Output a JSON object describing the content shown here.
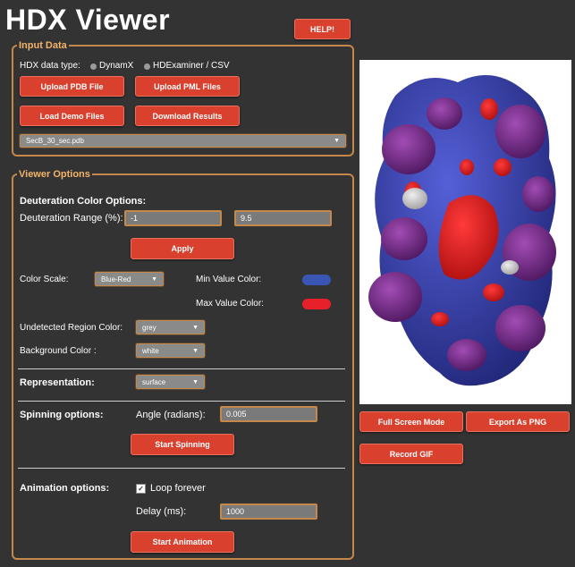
{
  "app": {
    "title": "HDX Viewer",
    "help_label": "HELP!"
  },
  "input_data": {
    "legend": "Input Data",
    "data_type_label": "HDX data type:",
    "options": [
      "DynamX",
      "HDExaminer / CSV"
    ],
    "upload_pdb_label": "Upload PDB File",
    "upload_pml_label": "Upload PML Files",
    "load_demo_label": "Load Demo Files",
    "download_results_label": "Download Results",
    "file_select_value": "SecB_30_sec.pdb"
  },
  "viewer_options": {
    "legend": "Viewer Options",
    "deuteration_heading": "Deuteration Color Options:",
    "range_label": "Deuteration Range (%):",
    "range_min": "-1",
    "range_max": "9.5",
    "apply_label": "Apply",
    "color_scale_label": "Color Scale:",
    "color_scale_value": "Blue-Red",
    "min_color_label": "Min Value Color:",
    "max_color_label": "Max Value Color:",
    "min_color": "#3a56b4",
    "max_color": "#e8202a",
    "undetected_label": "Undetected Region Color:",
    "undetected_value": "grey",
    "background_label": "Background Color :",
    "background_value": "white",
    "representation_label": "Representation:",
    "representation_value": "surface",
    "spinning_label": "Spinning options:",
    "angle_label": "Angle (radians):",
    "angle_value": "0.005",
    "start_spinning_label": "Start Spinning",
    "animation_label": "Animation options:",
    "loop_label": "Loop forever",
    "loop_checked": true,
    "delay_label": "Delay (ms):",
    "delay_value": "1000",
    "start_animation_label": "Start Animation"
  },
  "viewer_actions": {
    "fullscreen_label": "Full Screen Mode",
    "export_png_label": "Export As PNG",
    "record_gif_label": "Record GIF"
  },
  "colors": {
    "accent": "#d9402e",
    "panel_border": "#c5874a",
    "background": "#333333"
  }
}
